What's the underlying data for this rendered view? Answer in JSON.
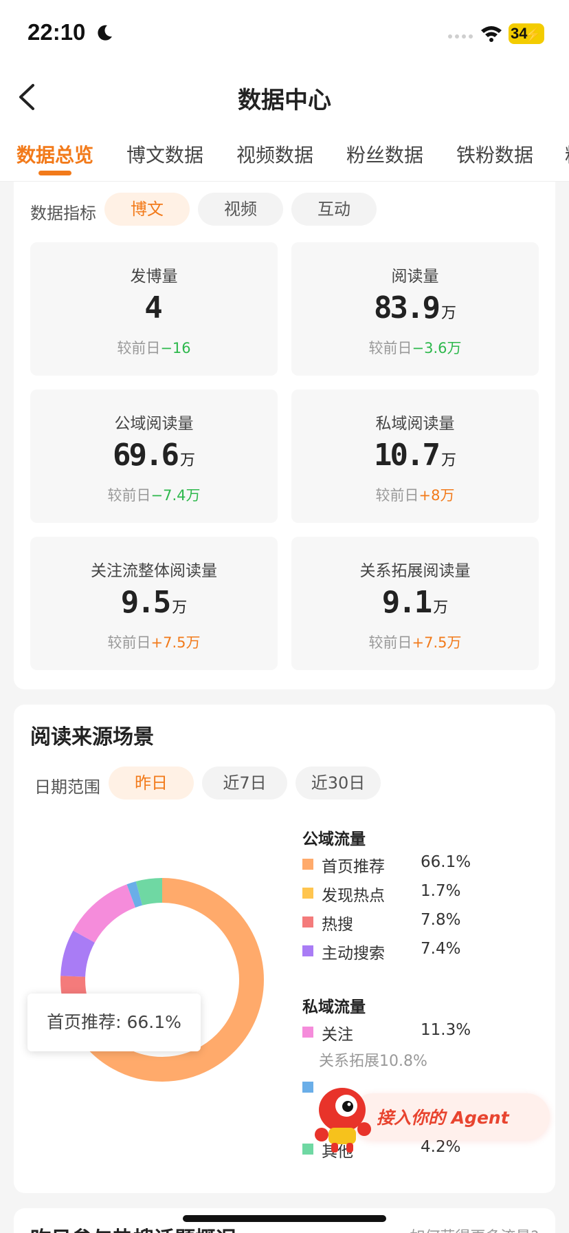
{
  "status_bar": {
    "time": "22:10",
    "battery": "34"
  },
  "nav": {
    "title": "数据中心"
  },
  "tabs": [
    {
      "label": "数据总览",
      "active": true
    },
    {
      "label": "博文数据",
      "active": false
    },
    {
      "label": "视频数据",
      "active": false
    },
    {
      "label": "粉丝数据",
      "active": false
    },
    {
      "label": "铁粉数据",
      "active": false
    },
    {
      "label": "粉",
      "active": false
    }
  ],
  "metrics_card": {
    "filter_label": "数据指标",
    "filters": [
      "博文",
      "视频",
      "互动"
    ],
    "active_filter": "博文",
    "compare_prefix": "较前日",
    "metrics": [
      {
        "label": "发博量",
        "value": "4",
        "unit": "",
        "change": "−16",
        "trend": "down"
      },
      {
        "label": "阅读量",
        "value": "83.9",
        "unit": "万",
        "change": "−3.6万",
        "trend": "down"
      },
      {
        "label": "公域阅读量",
        "value": "69.6",
        "unit": "万",
        "change": "−7.4万",
        "trend": "down"
      },
      {
        "label": "私域阅读量",
        "value": "10.7",
        "unit": "万",
        "change": "+8万",
        "trend": "up"
      },
      {
        "label": "关注流整体阅读量",
        "value": "9.5",
        "unit": "万",
        "change": "+7.5万",
        "trend": "up"
      },
      {
        "label": "关系拓展阅读量",
        "value": "9.1",
        "unit": "万",
        "change": "+7.5万",
        "trend": "up"
      }
    ]
  },
  "source_card": {
    "title": "阅读来源场景",
    "date_label": "日期范围",
    "ranges": [
      "昨日",
      "近7日",
      "近30日"
    ],
    "active_range": "昨日",
    "tooltip": "首页推荐: 66.1%",
    "public_title": "公域流量",
    "private_title": "私域流量",
    "private_sub": "关系拓展10.8%",
    "agent_label": "接入你的 Agent"
  },
  "chart_data": {
    "type": "pie",
    "groups": [
      {
        "name": "公域流量",
        "items": [
          {
            "name": "首页推荐",
            "value": 66.1,
            "color": "#ffaa6b"
          },
          {
            "name": "发现热点",
            "value": 1.7,
            "color": "#ffc54f"
          },
          {
            "name": "热搜",
            "value": 7.8,
            "color": "#f47b7b"
          },
          {
            "name": "主动搜索",
            "value": 7.4,
            "color": "#a97cf5"
          }
        ]
      },
      {
        "name": "私域流量",
        "items": [
          {
            "name": "关注",
            "value": 11.3,
            "color": "#f58cdb"
          },
          {
            "name": "",
            "value": 1.5,
            "color": "#6aaee8"
          },
          {
            "name": "其他",
            "value": 4.2,
            "color": "#6fd8a3"
          }
        ]
      }
    ],
    "display": [
      {
        "name": "首页推荐",
        "label": "66.1%"
      },
      {
        "name": "发现热点",
        "label": "1.7%"
      },
      {
        "name": "热搜",
        "label": "7.8%"
      },
      {
        "name": "主动搜索",
        "label": "7.4%"
      },
      {
        "name": "关注",
        "label": "11.3%"
      },
      {
        "name": "其他",
        "label": "4.2%"
      }
    ]
  },
  "next_card": {
    "title": "昨日参与热搜话题概况",
    "link": "如何获得更多流量?"
  }
}
